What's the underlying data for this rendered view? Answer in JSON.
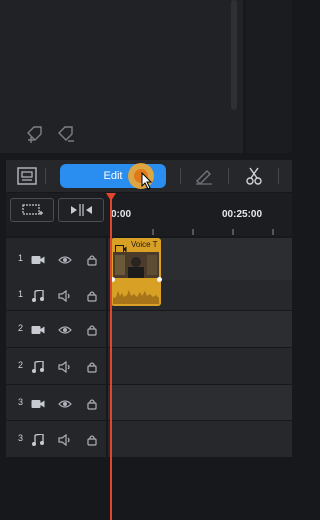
{
  "toolbar": {
    "edit_label": "Edit"
  },
  "timeline": {
    "time_start": "0:00",
    "time_mark": "00:25:00",
    "clip_title": "Voice T"
  },
  "tracks": [
    {
      "number": "1",
      "type": "video"
    },
    {
      "number": "1",
      "type": "audio"
    },
    {
      "number": "2",
      "type": "video"
    },
    {
      "number": "2",
      "type": "audio"
    },
    {
      "number": "3",
      "type": "video"
    },
    {
      "number": "3",
      "type": "audio"
    }
  ],
  "colors": {
    "accent": "#2a8df0",
    "playhead": "#e0452e",
    "clip": "#d8a025"
  }
}
